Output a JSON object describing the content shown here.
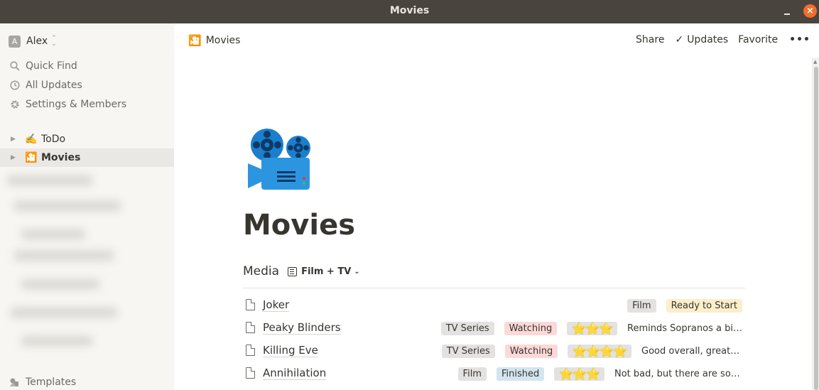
{
  "window": {
    "title": "Movies",
    "minimize": "_",
    "close": "×"
  },
  "sidebar": {
    "workspace": {
      "avatar": "A",
      "name": "Alex",
      "switch": "⌃⌄"
    },
    "nav": [
      {
        "label": "Quick Find",
        "icon": "search-icon"
      },
      {
        "label": "All Updates",
        "icon": "clock-icon"
      },
      {
        "label": "Settings & Members",
        "icon": "gear-icon"
      }
    ],
    "pages": [
      {
        "emoji": "✍️",
        "label": "ToDo",
        "active": false
      },
      {
        "emoji": "🎦",
        "label": "Movies",
        "active": true
      }
    ],
    "templates_label": "Templates"
  },
  "topbar": {
    "breadcrumb": {
      "emoji": "🎦",
      "label": "Movies"
    },
    "share": "Share",
    "updates": "Updates",
    "favorite": "Favorite",
    "more": "•••"
  },
  "page": {
    "icon": "cinema-emoji-icon",
    "title": "Movies",
    "database": {
      "name": "Media",
      "view": "Film + TV",
      "rows": [
        {
          "name": "Joker",
          "type": "Film",
          "type_color": "#e3e2e0",
          "status": "Ready to Start",
          "status_color": "#fbeecb",
          "rating": "",
          "note": ""
        },
        {
          "name": "Peaky Blinders",
          "type": "TV Series",
          "type_color": "#e3e2e0",
          "status": "Watching",
          "status_color": "#fbd9d9",
          "rating": "⭐⭐⭐",
          "note": "Reminds Sopranos a bit,..."
        },
        {
          "name": "Killing Eve",
          "type": "TV Series",
          "type_color": "#e3e2e0",
          "status": "Watching",
          "status_color": "#fbd9d9",
          "rating": "⭐⭐⭐⭐",
          "note": "Good overall, great s..."
        },
        {
          "name": "Annihilation",
          "type": "Film",
          "type_color": "#e3e2e0",
          "status": "Finished",
          "status_color": "#d3e5ef",
          "rating": "⭐⭐⭐",
          "note": "Not bad, but there are som..."
        }
      ]
    }
  }
}
